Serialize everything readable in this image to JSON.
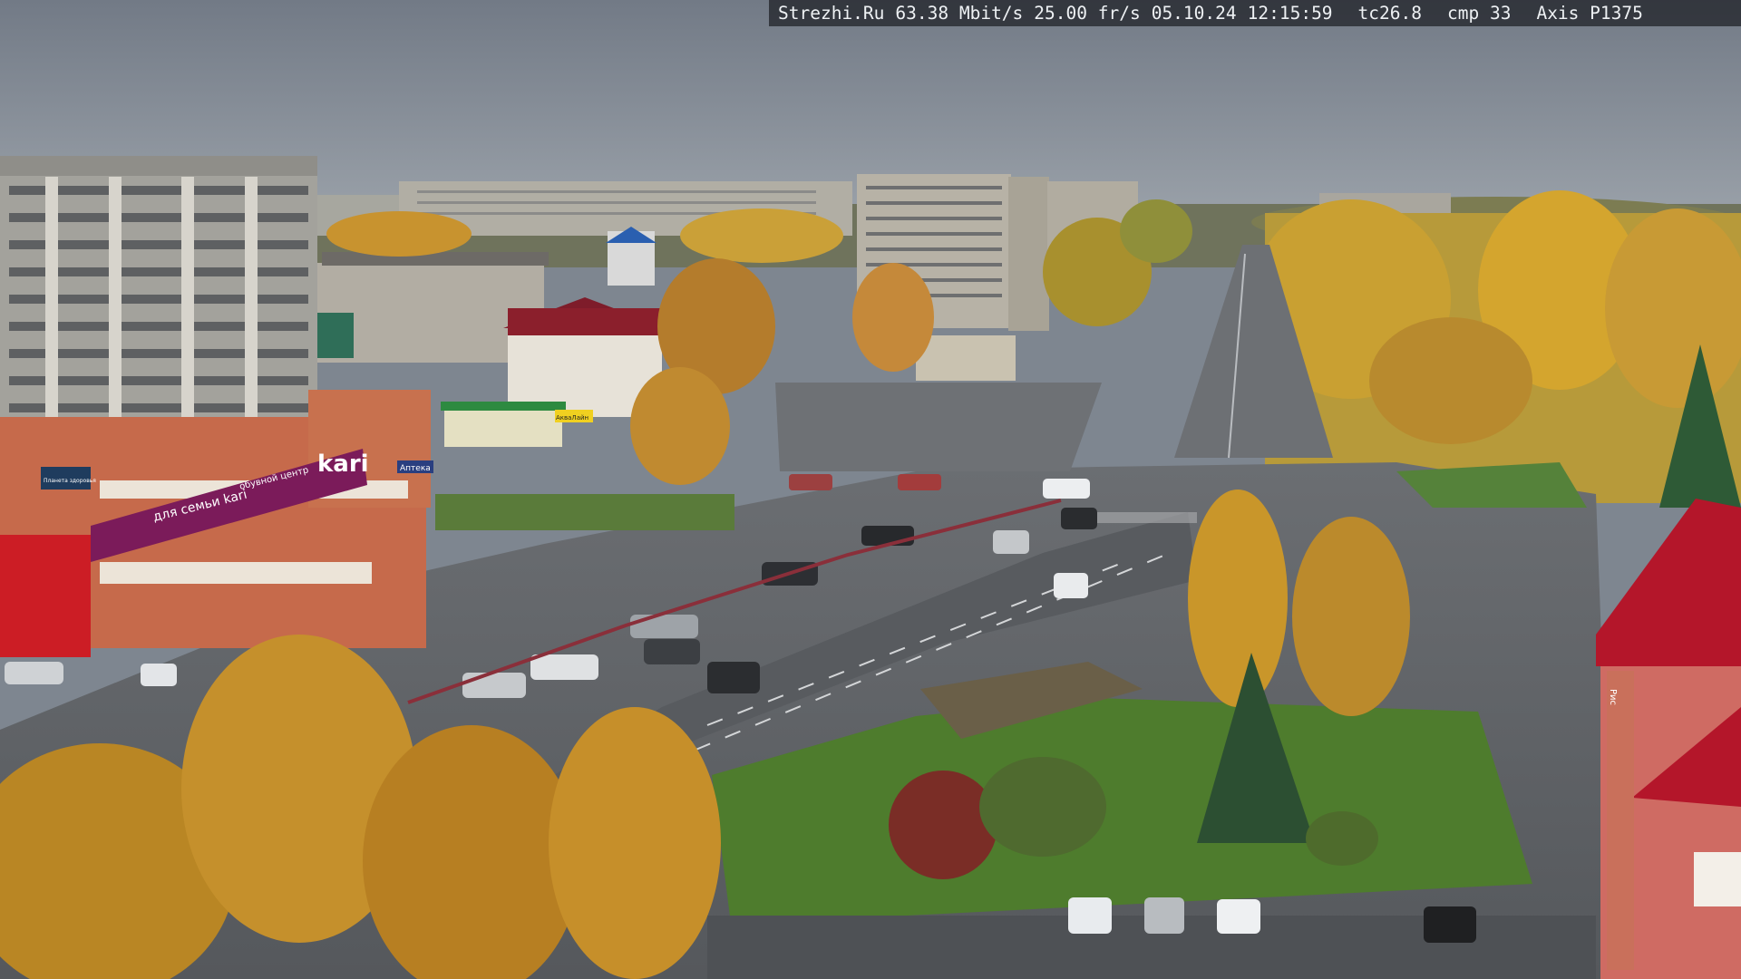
{
  "overlay": {
    "site": "Strezhi.Ru",
    "bitrate": "63.38 Mbit/s",
    "framerate": "25.00 fr/s",
    "date": "05.10.24",
    "time": "12:15:59",
    "tc": "tc26.8",
    "cmp": "cmp 33",
    "camera": "Axis P1375"
  },
  "signage": {
    "store_sign": "kari",
    "store_sign_secondary": "для семьи kari",
    "store_sign_small": "обувной центр",
    "left_sign": "Планета здоровья",
    "pharmacy_sign": "Аптека",
    "akvilon_sign": "АкваЛайн",
    "panel_sign": "Рис"
  },
  "colors": {
    "sky": "#7b8390",
    "foliage": "#c6902e",
    "grass": "#4b7a2e",
    "asphalt": "#5b5e62",
    "kari_purple": "#7b1b5a",
    "red_roof": "#b4162a"
  }
}
